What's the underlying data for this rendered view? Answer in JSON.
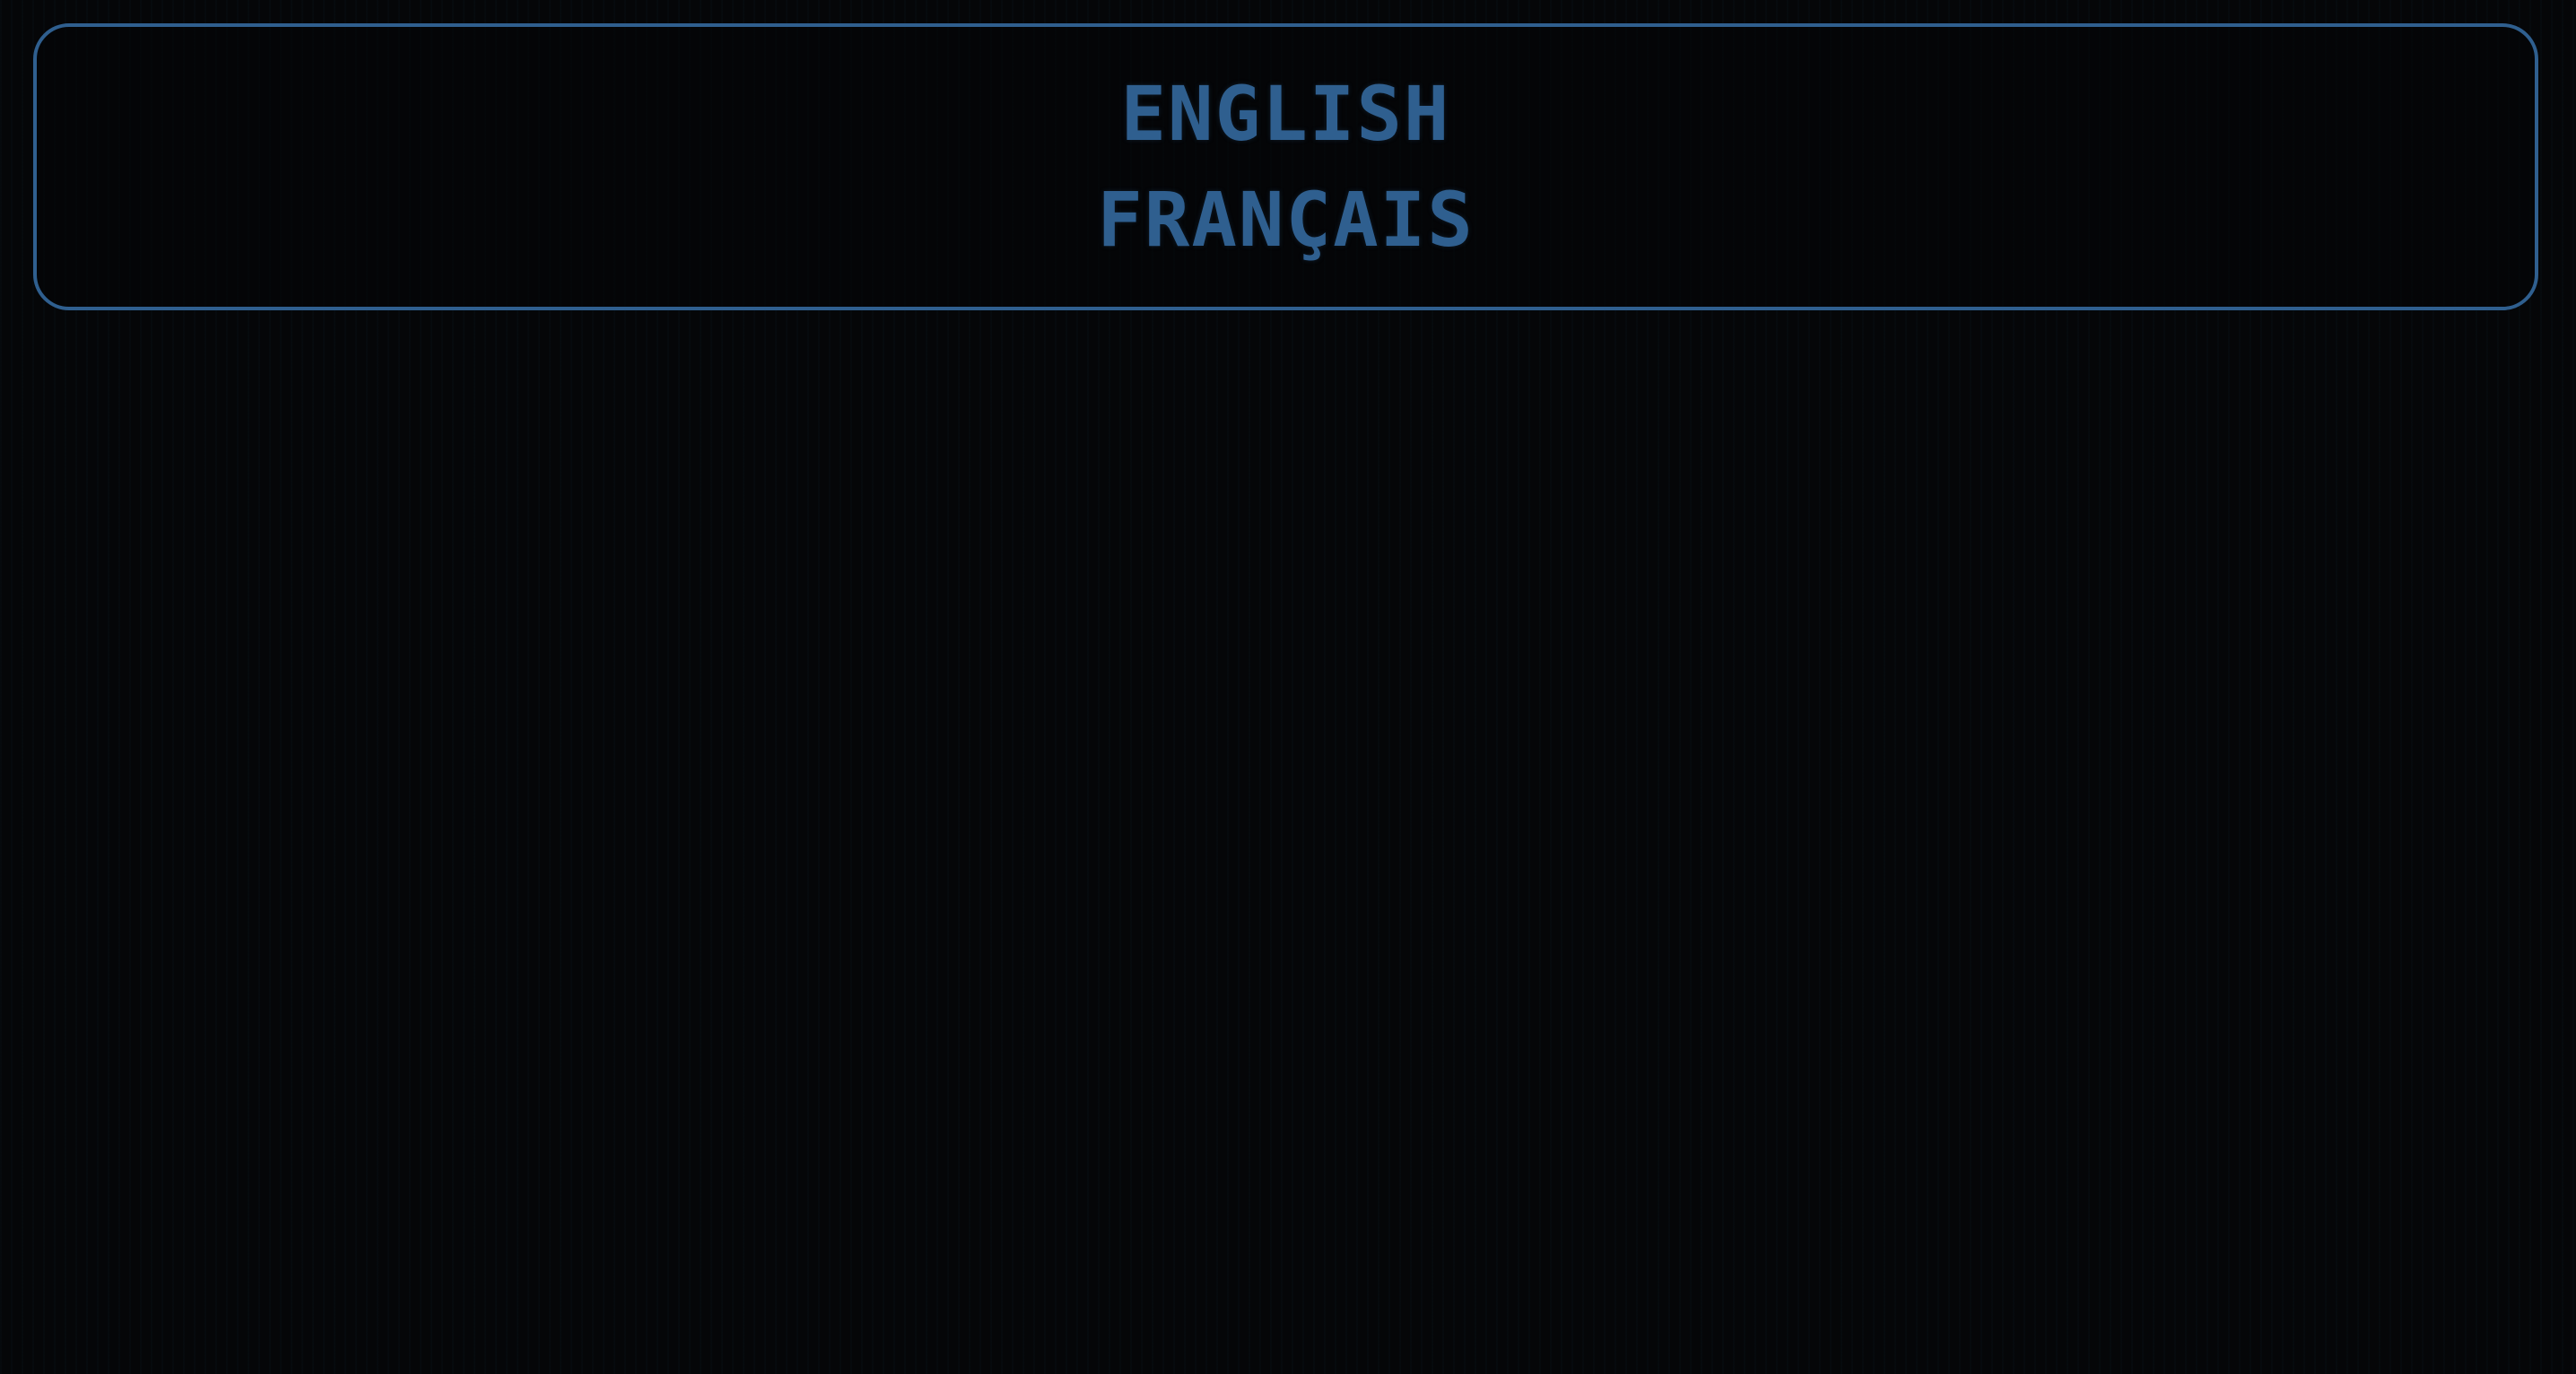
{
  "language_menu": {
    "options": [
      {
        "label": "ENGLISH"
      },
      {
        "label": "FRANÇAIS"
      }
    ]
  },
  "colors": {
    "background": "#050608",
    "accent": "#2f5f8f"
  }
}
